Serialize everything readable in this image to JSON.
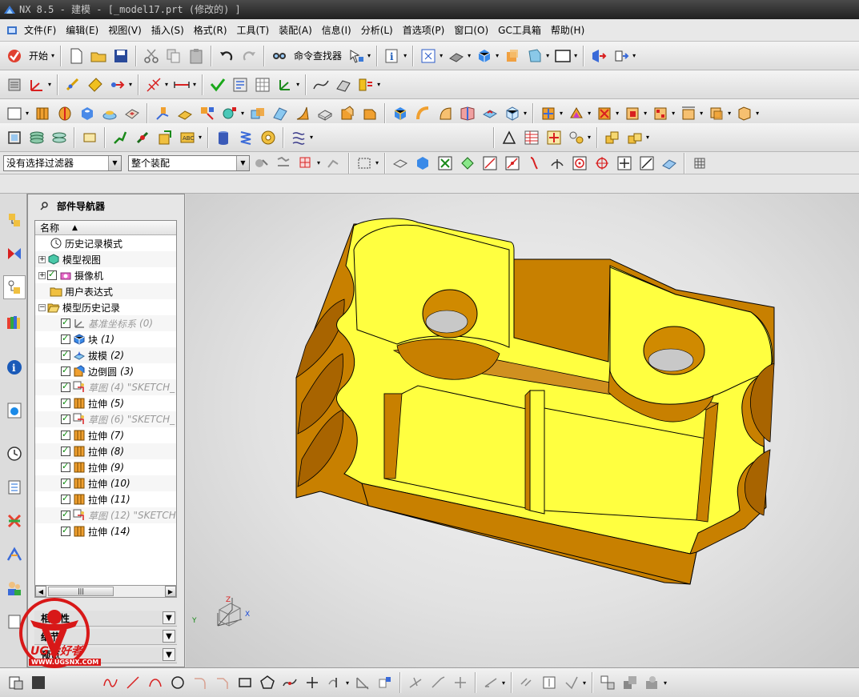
{
  "window": {
    "title": "NX 8.5 - 建模 - [_model17.prt  (修改的) ]"
  },
  "menu": {
    "items": [
      "文件(F)",
      "编辑(E)",
      "视图(V)",
      "插入(S)",
      "格式(R)",
      "工具(T)",
      "装配(A)",
      "信息(I)",
      "分析(L)",
      "首选项(P)",
      "窗口(O)",
      "GC工具箱",
      "帮助(H)"
    ]
  },
  "toolbar": {
    "start_label": "开始",
    "command_finder_label": "命令查找器"
  },
  "selection_bar": {
    "filter_value": "没有选择过滤器",
    "scope_value": "整个装配"
  },
  "navigator": {
    "title": "部件导航器",
    "column_header": "名称",
    "items": [
      {
        "label": "历史记录模式",
        "num": "",
        "expander": "",
        "checked": false,
        "grey": false,
        "icon": "clock-icon",
        "indent": 1
      },
      {
        "label": "模型视图",
        "num": "",
        "expander": "+",
        "checked": false,
        "grey": false,
        "icon": "model-views-icon",
        "indent": 0
      },
      {
        "label": "摄像机",
        "num": "",
        "expander": "+",
        "checked": true,
        "grey": false,
        "icon": "camera-icon",
        "indent": 0
      },
      {
        "label": "用户表达式",
        "num": "",
        "expander": "",
        "checked": false,
        "grey": false,
        "icon": "folder-icon",
        "indent": 1
      },
      {
        "label": "模型历史记录",
        "num": "",
        "expander": "−",
        "checked": false,
        "grey": false,
        "icon": "folder-open-icon",
        "indent": 0
      },
      {
        "label": "基准坐标系",
        "num": "(0)",
        "expander": "",
        "checked": true,
        "grey": true,
        "icon": "datum-csys-icon",
        "indent": 2
      },
      {
        "label": "块",
        "num": "(1)",
        "expander": "",
        "checked": true,
        "grey": false,
        "icon": "block-icon",
        "indent": 2
      },
      {
        "label": "拔模",
        "num": "(2)",
        "expander": "",
        "checked": true,
        "grey": false,
        "icon": "draft-icon",
        "indent": 2
      },
      {
        "label": "边倒圆",
        "num": "(3)",
        "expander": "",
        "checked": true,
        "grey": false,
        "icon": "edge-blend-icon",
        "indent": 2
      },
      {
        "label": "草图",
        "num": "(4) \"SKETCH_",
        "expander": "",
        "checked": true,
        "grey": true,
        "icon": "sketch-icon",
        "indent": 2
      },
      {
        "label": "拉伸",
        "num": "(5)",
        "expander": "",
        "checked": true,
        "grey": false,
        "icon": "extrude-icon",
        "indent": 2
      },
      {
        "label": "草图",
        "num": "(6) \"SKETCH_",
        "expander": "",
        "checked": true,
        "grey": true,
        "icon": "sketch-icon",
        "indent": 2
      },
      {
        "label": "拉伸",
        "num": "(7)",
        "expander": "",
        "checked": true,
        "grey": false,
        "icon": "extrude-icon",
        "indent": 2
      },
      {
        "label": "拉伸",
        "num": "(8)",
        "expander": "",
        "checked": true,
        "grey": false,
        "icon": "extrude-icon",
        "indent": 2
      },
      {
        "label": "拉伸",
        "num": "(9)",
        "expander": "",
        "checked": true,
        "grey": false,
        "icon": "extrude-icon",
        "indent": 2
      },
      {
        "label": "拉伸",
        "num": "(10)",
        "expander": "",
        "checked": true,
        "grey": false,
        "icon": "extrude-icon",
        "indent": 2
      },
      {
        "label": "拉伸",
        "num": "(11)",
        "expander": "",
        "checked": true,
        "grey": false,
        "icon": "extrude-icon",
        "indent": 2
      },
      {
        "label": "草图",
        "num": "(12) \"SKETCH",
        "expander": "",
        "checked": true,
        "grey": true,
        "icon": "sketch-icon",
        "indent": 2
      },
      {
        "label": "拉伸",
        "num": "(14)",
        "expander": "",
        "checked": true,
        "grey": false,
        "icon": "extrude-icon",
        "indent": 2
      }
    ],
    "sections": [
      "相关性",
      "细节",
      "预览"
    ]
  },
  "triad": {
    "x_label": "X",
    "y_label": "Y",
    "z_label": "Z"
  },
  "watermark": {
    "site": "WWW.UGSNX.COM",
    "name": "UG爱好者"
  },
  "colors": {
    "model_top": "#ffff40",
    "model_side": "#d08a00",
    "model_dark": "#8a5200",
    "edge": "#000000",
    "check_green": "#0a8a0a"
  }
}
